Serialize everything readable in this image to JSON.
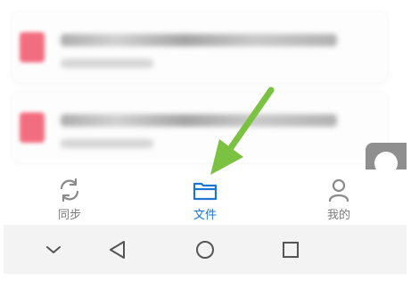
{
  "tabs": [
    {
      "label": "同步",
      "icon": "sync-icon",
      "active": false
    },
    {
      "label": "文件",
      "icon": "folder-icon",
      "active": true
    },
    {
      "label": "我的",
      "icon": "person-icon",
      "active": false
    }
  ],
  "system_nav": {
    "buttons": [
      "chevron-down-icon",
      "back-triangle-icon",
      "home-circle-icon",
      "recents-square-icon"
    ]
  },
  "colors": {
    "active_tab": "#1e74d0",
    "inactive_tab": "#7b7b7b",
    "file_icon": "#f26d7f",
    "arrow": "#7cc242"
  }
}
